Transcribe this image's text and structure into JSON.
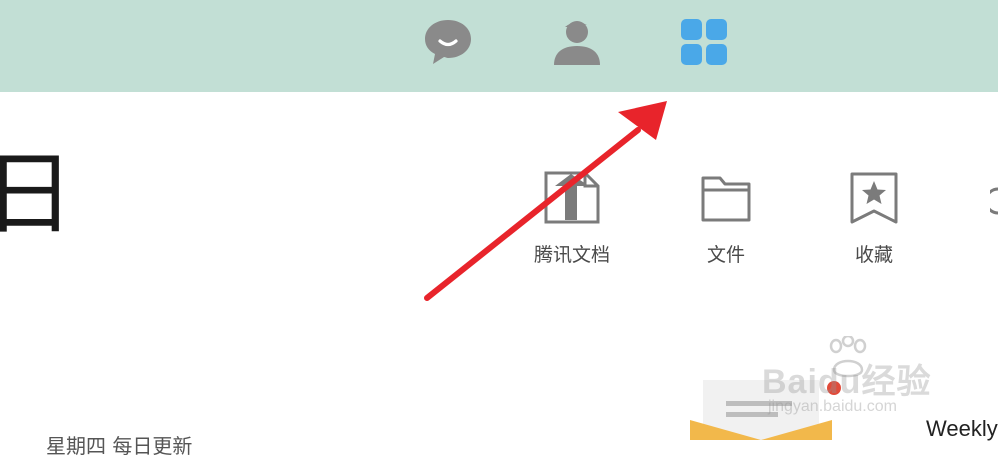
{
  "top_nav": {
    "tabs": [
      {
        "id": "chat",
        "icon": "chat-bubble-icon",
        "color": "#8a8a8a"
      },
      {
        "id": "contacts",
        "icon": "person-icon",
        "color": "#8a8a8a"
      },
      {
        "id": "workspace",
        "icon": "grid-apps-icon",
        "color": "#4aa8e8",
        "active": true
      }
    ],
    "background_color": "#c2dfd5"
  },
  "header": {
    "partial_title_char": "日"
  },
  "tools": [
    {
      "label": "腾讯文档",
      "icon": "tencent-docs-icon"
    },
    {
      "label": "文件",
      "icon": "folder-icon"
    },
    {
      "label": "收藏",
      "icon": "bookmark-star-icon"
    }
  ],
  "annotation": {
    "arrow_color": "#e8242b"
  },
  "content": {
    "weekly_label": "Weekly",
    "bottom_fragment": "星期四 每日更新"
  },
  "watermark": {
    "brand": "Baidu经验",
    "url": "jingyan.baidu.com"
  }
}
